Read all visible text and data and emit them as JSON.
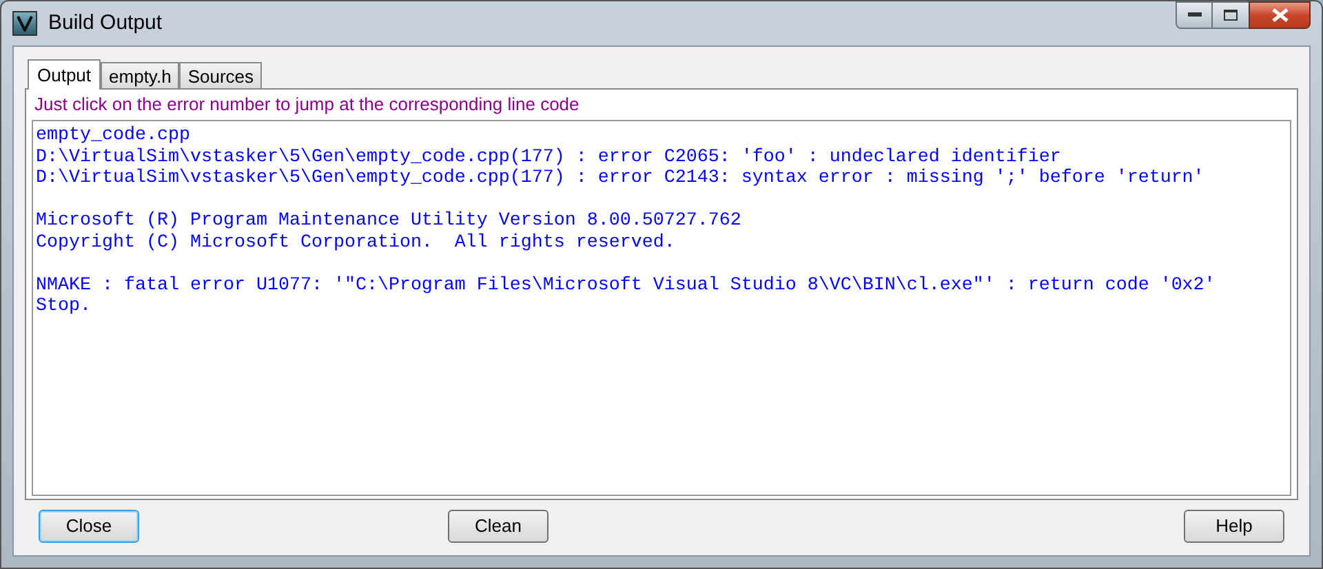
{
  "window": {
    "title": "Build Output"
  },
  "tabs": [
    {
      "label": "Output",
      "selected": true
    },
    {
      "label": "empty.h",
      "selected": false
    },
    {
      "label": "Sources",
      "selected": false
    }
  ],
  "hint": "Just click on the error number to jump at the corresponding line code",
  "output_blocks": [
    [
      "empty_code.cpp",
      "D:\\VirtualSim\\vstasker\\5\\Gen\\empty_code.cpp(177) : error C2065: 'foo' : undeclared identifier",
      "D:\\VirtualSim\\vstasker\\5\\Gen\\empty_code.cpp(177) : error C2143: syntax error : missing ';' before 'return'"
    ],
    [
      "Microsoft (R) Program Maintenance Utility Version 8.00.50727.762",
      "Copyright (C) Microsoft Corporation.  All rights reserved."
    ],
    [
      "NMAKE : fatal error U1077: '\"C:\\Program Files\\Microsoft Visual Studio 8\\VC\\BIN\\cl.exe\"' : return code '0x2'",
      "Stop."
    ]
  ],
  "buttons": [
    {
      "label": "Close",
      "default": true
    },
    {
      "label": "Clean",
      "default": false
    },
    {
      "label": "Help",
      "default": false
    }
  ]
}
